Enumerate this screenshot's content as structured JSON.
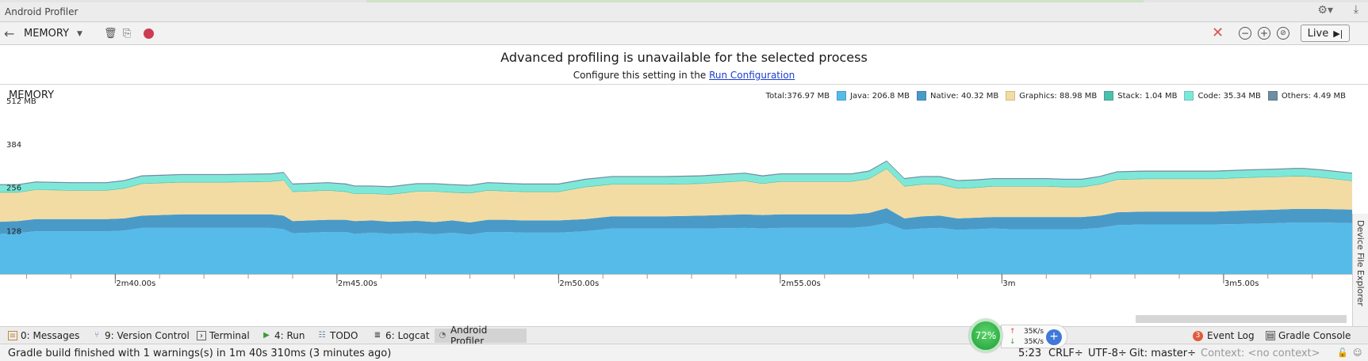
{
  "window": {
    "title": "Android Profiler"
  },
  "toolbar": {
    "monitor_select": "MEMORY",
    "live_label": "Live"
  },
  "banner": {
    "heading": "Advanced profiling is unavailable for the selected process",
    "sub_prefix": "Configure this setting in the",
    "link": "Run Configuration"
  },
  "chart_data": {
    "type": "area",
    "title": "MEMORY",
    "y_tick_labels": [
      "512 MB",
      "384",
      "256",
      "128"
    ],
    "x_tick_labels": [
      "2m40.00s",
      "2m45.00s",
      "2m50.00s",
      "2m55.00s",
      "3m",
      "3m5.00s"
    ],
    "x_ticks_s": [
      160,
      165,
      170,
      175,
      180,
      185
    ],
    "xlim_s": [
      157.4,
      187.9
    ],
    "ylim_mb": [
      0,
      512
    ],
    "stacking": "stacked",
    "legend": {
      "total": "Total:376.97 MB",
      "items": [
        {
          "label": "Java:",
          "value": "206.8 MB",
          "color": "#56bbe9"
        },
        {
          "label": "Native:",
          "value": "40.32 MB",
          "color": "#4a9ac8"
        },
        {
          "label": "Graphics:",
          "value": "88.98 MB",
          "color": "#f3dca3"
        },
        {
          "label": "Stack:",
          "value": "1.04 MB",
          "color": "#4dc0ac"
        },
        {
          "label": "Code:",
          "value": "35.34 MB",
          "color": "#7ee8d8"
        },
        {
          "label": "Others:",
          "value": "4.49 MB",
          "color": "#6e8ea2"
        }
      ]
    },
    "x": [
      157.4,
      157.8,
      158.2,
      159.0,
      159.8,
      160.2,
      160.6,
      161.5,
      162.5,
      163.5,
      163.8,
      164.0,
      164.8,
      165.2,
      165.4,
      165.8,
      166.2,
      166.8,
      167.2,
      167.6,
      168.0,
      168.4,
      168.8,
      169.2,
      169.6,
      170.0,
      170.6,
      171.2,
      171.6,
      171.8,
      172.4,
      173.2,
      174.2,
      174.6,
      175.0,
      175.4,
      175.8,
      176.2,
      176.6,
      177.0,
      177.4,
      177.8,
      178.2,
      178.6,
      179.0,
      179.4,
      179.8,
      180.2,
      180.6,
      181.0,
      181.4,
      181.8,
      182.2,
      182.6,
      183.2,
      184.0,
      184.8,
      185.6,
      186.2,
      186.6,
      186.8,
      187.2,
      187.9
    ],
    "series": [
      {
        "name": "Java",
        "values": [
          118,
          120,
          126,
          126,
          126,
          128,
          136,
          136,
          136,
          136,
          132,
          120,
          124,
          124,
          118,
          122,
          118,
          121,
          117,
          122,
          116,
          124,
          124,
          122,
          122,
          122,
          126,
          134,
          134,
          134,
          134,
          134,
          136,
          134,
          136,
          136,
          136,
          136,
          136,
          140,
          150,
          130,
          134,
          136,
          130,
          132,
          134,
          132,
          132,
          132,
          132,
          132,
          136,
          144,
          146,
          146,
          146,
          148,
          150,
          152,
          152,
          152,
          150
        ]
      },
      {
        "name": "Native",
        "values": [
          36,
          36,
          36,
          36,
          36,
          36,
          36,
          40,
          40,
          40,
          40,
          36,
          36,
          36,
          38,
          36,
          36,
          36,
          36,
          36,
          36,
          36,
          36,
          36,
          36,
          36,
          36,
          36,
          36,
          36,
          36,
          38,
          40,
          40,
          40,
          40,
          40,
          40,
          40,
          40,
          44,
          34,
          36,
          36,
          34,
          34,
          34,
          36,
          36,
          36,
          36,
          36,
          36,
          38,
          38,
          38,
          38,
          40,
          40,
          40,
          40,
          40,
          40
        ]
      },
      {
        "name": "Graphics",
        "values": [
          86,
          84,
          86,
          84,
          84,
          88,
          94,
          94,
          94,
          96,
          104,
          86,
          86,
          82,
          80,
          78,
          80,
          86,
          90,
          82,
          86,
          86,
          84,
          84,
          84,
          84,
          94,
          94,
          94,
          94,
          94,
          94,
          98,
          92,
          96,
          96,
          96,
          96,
          96,
          100,
          116,
          94,
          94,
          92,
          88,
          88,
          90,
          90,
          90,
          90,
          88,
          88,
          92,
          96,
          96,
          96,
          96,
          96,
          96,
          96,
          96,
          92,
          84
        ]
      },
      {
        "name": "Stack",
        "values": [
          2,
          2,
          2,
          2,
          2,
          2,
          2,
          2,
          2,
          2,
          2,
          2,
          2,
          2,
          2,
          2,
          2,
          2,
          2,
          2,
          2,
          2,
          2,
          2,
          2,
          2,
          2,
          2,
          2,
          2,
          2,
          2,
          2,
          2,
          2,
          2,
          2,
          2,
          2,
          2,
          2,
          2,
          2,
          2,
          2,
          2,
          2,
          2,
          2,
          2,
          2,
          2,
          2,
          2,
          2,
          2,
          2,
          2,
          2,
          2,
          2,
          2,
          2
        ]
      },
      {
        "name": "Code",
        "values": [
          20,
          20,
          20,
          20,
          20,
          20,
          20,
          20,
          20,
          20,
          20,
          20,
          20,
          20,
          20,
          20,
          20,
          20,
          20,
          20,
          20,
          20,
          20,
          20,
          20,
          20,
          20,
          20,
          20,
          20,
          20,
          20,
          20,
          20,
          20,
          20,
          20,
          20,
          20,
          20,
          20,
          20,
          20,
          20,
          20,
          20,
          20,
          20,
          20,
          20,
          20,
          20,
          20,
          20,
          20,
          20,
          20,
          20,
          20,
          20,
          20,
          20,
          20
        ]
      },
      {
        "name": "Others",
        "values": [
          3,
          3,
          3,
          3,
          3,
          3,
          3,
          3,
          3,
          3,
          3,
          3,
          3,
          3,
          3,
          3,
          3,
          3,
          3,
          3,
          3,
          3,
          3,
          3,
          3,
          3,
          3,
          3,
          3,
          3,
          3,
          3,
          3,
          3,
          3,
          3,
          3,
          3,
          3,
          3,
          3,
          3,
          3,
          3,
          3,
          3,
          3,
          3,
          3,
          3,
          3,
          3,
          3,
          3,
          3,
          3,
          3,
          3,
          3,
          3,
          3,
          3,
          3
        ]
      }
    ],
    "grid": false
  },
  "side_panel": {
    "label": "Device File Explorer"
  },
  "tool_windows": {
    "messages": "0: Messages",
    "version_control": "9: Version Control",
    "terminal": "Terminal",
    "run": "4: Run",
    "todo": "TODO",
    "logcat": "6: Logcat",
    "profiler": "Android Profiler",
    "event_log": "Event Log",
    "event_log_count": "3",
    "gradle_console": "Gradle Console"
  },
  "net_widget": {
    "percent": "72%",
    "up": "35K/s",
    "down": "35K/s"
  },
  "status": {
    "message": "Gradle build finished with 1 warnings(s) in 1m 40s 310ms (3 minutes ago)",
    "position": "5:23",
    "line_sep": "CRLF÷",
    "encoding": "UTF-8÷",
    "git": "Git: master÷",
    "context": "Context: <no context>"
  },
  "colors": {
    "accent_link": "#1b3ecf",
    "record": "#cc3c52",
    "stop": "#d9534f"
  }
}
